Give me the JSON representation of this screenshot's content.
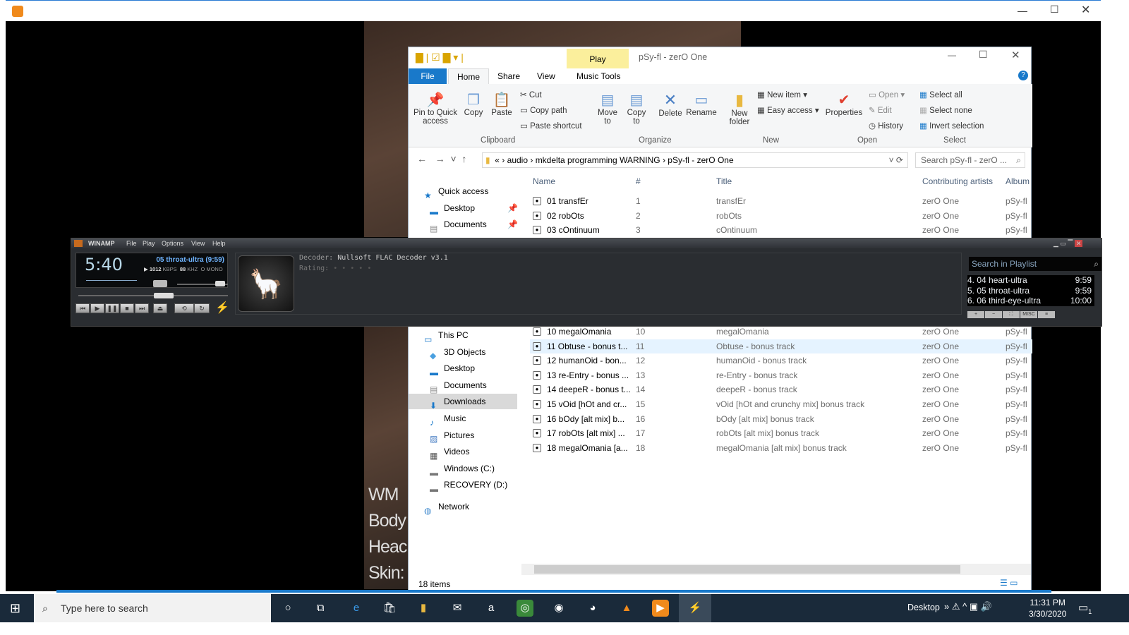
{
  "explorer": {
    "quick_tab": "Play",
    "title": "pSy-fl - zerO One",
    "tabs": [
      "File",
      "Home",
      "Share",
      "View",
      "Music Tools"
    ],
    "ribbon": {
      "pin": "Pin to Quick access",
      "copy": "Copy",
      "paste": "Paste",
      "cut": "Cut",
      "copy_path": "Copy path",
      "paste_shortcut": "Paste shortcut",
      "move_to": "Move to",
      "copy_to": "Copy to",
      "delete": "Delete",
      "rename": "Rename",
      "new_folder": "New folder",
      "new_item": "New item",
      "easy_access": "Easy access",
      "properties": "Properties",
      "open": "Open",
      "edit": "Edit",
      "history": "History",
      "select_all": "Select all",
      "select_none": "Select none",
      "invert_selection": "Invert selection",
      "groups": [
        "Clipboard",
        "Organize",
        "New",
        "Open",
        "Select"
      ]
    },
    "breadcrumb": [
      "«",
      "audio",
      "mkdelta programming WARNING",
      "pSy-fl - zerO One"
    ],
    "search_placeholder": "Search pSy-fl - zerO ...",
    "columns": [
      "Name",
      "#",
      "Title",
      "Contributing artists",
      "Album"
    ],
    "rows_top": [
      {
        "name": "01 transfEr",
        "num": "1",
        "title": "transfEr",
        "artist": "zerO One",
        "album": "pSy-fl"
      },
      {
        "name": "02 robOts",
        "num": "2",
        "title": "robOts",
        "artist": "zerO One",
        "album": "pSy-fl"
      },
      {
        "name": "03 cOntinuum",
        "num": "3",
        "title": "cOntinuum",
        "artist": "zerO One",
        "album": "pSy-fl"
      }
    ],
    "rows": [
      {
        "name": "10 megalOmania",
        "num": "10",
        "title": "megalOmania",
        "artist": "zerO One",
        "album": "pSy-fl"
      },
      {
        "name": "11 Obtuse - bonus t...",
        "num": "11",
        "title": "Obtuse - bonus track",
        "artist": "zerO One",
        "album": "pSy-fl"
      },
      {
        "name": "12 humanOid - bon...",
        "num": "12",
        "title": "humanOid - bonus track",
        "artist": "zerO One",
        "album": "pSy-fl"
      },
      {
        "name": "13 re-Entry - bonus ...",
        "num": "13",
        "title": "re-Entry - bonus track",
        "artist": "zerO One",
        "album": "pSy-fl"
      },
      {
        "name": "14 deepeR - bonus t...",
        "num": "14",
        "title": "deepeR - bonus track",
        "artist": "zerO One",
        "album": "pSy-fl"
      },
      {
        "name": "15 vOid [hOt and cr...",
        "num": "15",
        "title": "vOid [hOt and crunchy mix] bonus track",
        "artist": "zerO One",
        "album": "pSy-fl"
      },
      {
        "name": "16 bOdy [alt mix] b...",
        "num": "16",
        "title": "bOdy [alt mix] bonus track",
        "artist": "zerO One",
        "album": "pSy-fl"
      },
      {
        "name": "17 robOts [alt mix] ...",
        "num": "17",
        "title": "robOts [alt mix] bonus track",
        "artist": "zerO One",
        "album": "pSy-fl"
      },
      {
        "name": "18 megalOmania [a...",
        "num": "18",
        "title": "megalOmania [alt mix] bonus track",
        "artist": "zerO One",
        "album": "pSy-fl"
      }
    ],
    "nav_top": [
      "Quick access",
      "Desktop",
      "Documents"
    ],
    "nav": [
      "This PC",
      "3D Objects",
      "Desktop",
      "Documents",
      "Downloads",
      "Music",
      "Pictures",
      "Videos",
      "Windows (C:)",
      "RECOVERY (D:)",
      "Network"
    ],
    "status": "18 items"
  },
  "winamp": {
    "title": "WINAMP",
    "menu": [
      "File",
      "Play",
      "Options",
      "View",
      "Help"
    ],
    "time": "5:40",
    "track": "05 throat-ultra (9:59)",
    "kbps": "1012",
    "kbps_unit": "KBPS",
    "khz": "88",
    "khz_unit": "KHZ",
    "mode": "O MONO",
    "decoder_label": "Decoder:",
    "decoder": "Nullsoft FLAC Decoder v3.1",
    "rating_label": "Rating:",
    "rating": "• • • • •",
    "seek_fraction": 0.57,
    "volume_fraction": 0.85,
    "playlist_search": "Search in Playlist",
    "playlist": [
      {
        "t": "4. 04 heart-ultra",
        "d": "9:59"
      },
      {
        "t": "5. 05 throat-ultra",
        "d": "9:59"
      },
      {
        "t": "6. 06 third-eye-ultra",
        "d": "10:00"
      }
    ],
    "pl_buttons": [
      "+",
      "−",
      "⛶",
      "MISC",
      "≡"
    ]
  },
  "background_text": [
    "WM",
    "Body",
    "Heac",
    "Skin:"
  ],
  "taskbar": {
    "search": "Type here to search",
    "desktop": "Desktop",
    "time": "11:31 PM",
    "date": "3/30/2020",
    "notif": "1"
  },
  "colors": {
    "accent": "#0063b1",
    "winamp_text": "#6fb4ff",
    "explorer_selected": "#cce8ff"
  }
}
